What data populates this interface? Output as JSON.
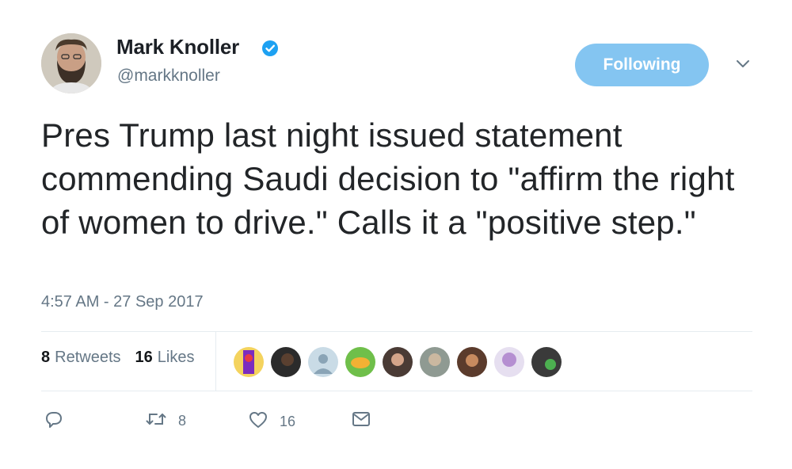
{
  "author": {
    "display_name": "Mark Knoller",
    "handle": "@markknoller",
    "verified": true
  },
  "follow_button": {
    "label": "Following"
  },
  "tweet": {
    "text": "Pres Trump last night issued statement commending Saudi decision to \"affirm the right of women to drive.\" Calls it a \"positive step.\"",
    "timestamp": "4:57 AM - 27 Sep 2017"
  },
  "stats": {
    "retweets_count": "8",
    "retweets_label": "Retweets",
    "likes_count": "16",
    "likes_label": "Likes"
  },
  "actions": {
    "retweet_count": "8",
    "like_count": "16"
  },
  "colors": {
    "accent": "#1da1f2",
    "follow_button_bg": "#84c5f1",
    "muted_text": "#657786"
  },
  "icons": [
    "verified-icon",
    "chevron-down-icon",
    "reply-icon",
    "retweet-icon",
    "heart-icon",
    "envelope-icon"
  ]
}
